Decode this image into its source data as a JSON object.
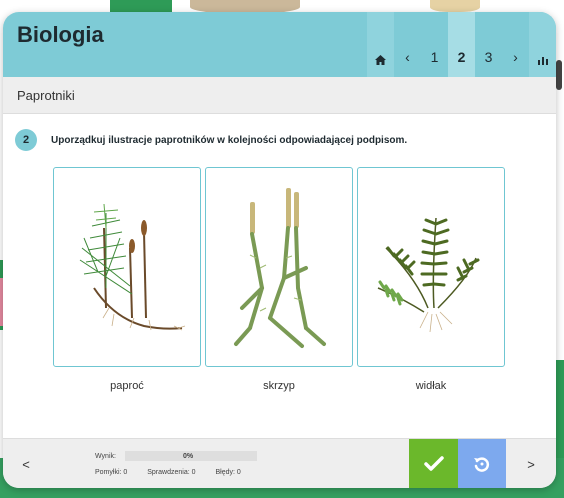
{
  "header": {
    "title": "Biologia",
    "nav": {
      "home_icon": "home-icon",
      "prev": "‹",
      "pages": [
        "1",
        "2",
        "3"
      ],
      "active_page": "2",
      "next": "›",
      "stats_icon": "bar-chart-icon"
    }
  },
  "section": {
    "title": "Paprotniki"
  },
  "task": {
    "number": "2",
    "instruction": "Uporządkuj ilustracje paprotników w kolejności odpowiadającej podpisom."
  },
  "cards": [
    {
      "image": "horsetail-illustration",
      "caption": "paproć"
    },
    {
      "image": "clubmoss-illustration",
      "caption": "skrzyp"
    },
    {
      "image": "fern-illustration",
      "caption": "widłak"
    }
  ],
  "footer": {
    "prev": "<",
    "next": ">",
    "score_label": "Wynik:",
    "score_value": "0%",
    "mistakes": "Pomyłki: 0",
    "checks": "Sprawdzenia: 0",
    "errors": "Błędy: 0",
    "check_icon": "checkmark-icon",
    "reset_icon": "reset-icon"
  },
  "colors": {
    "header": "#7ecbd6",
    "card_border": "#6fc6d2",
    "check_button": "#6bb82b",
    "reset_button": "#7da9ee"
  }
}
